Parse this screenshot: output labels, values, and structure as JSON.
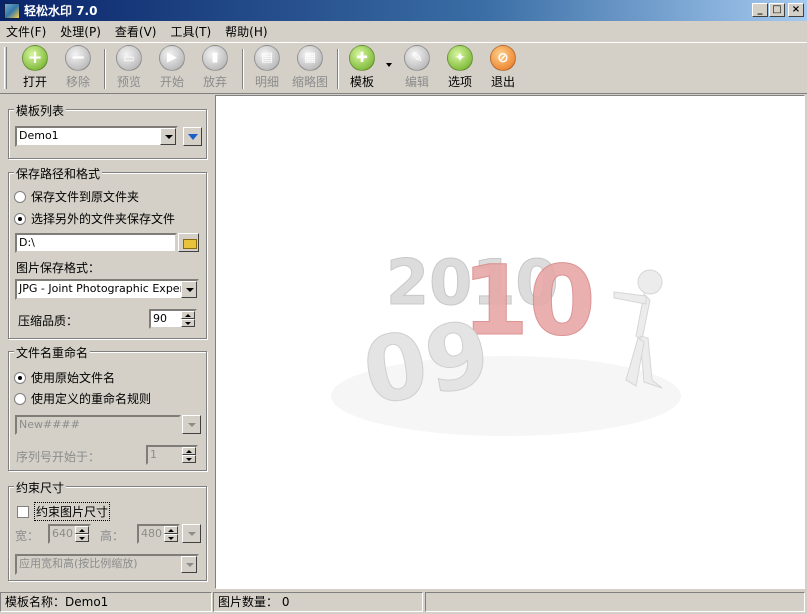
{
  "window": {
    "title": "轻松水印 7.0",
    "buttons": {
      "minimize": "_",
      "maximize": "□",
      "close": "×"
    }
  },
  "menu": [
    "文件(F)",
    "处理(P)",
    "查看(V)",
    "工具(T)",
    "帮助(H)"
  ],
  "toolbar": {
    "open": "打开",
    "remove": "移除",
    "preview": "预览",
    "start": "开始",
    "abandon": "放弃",
    "detail": "明细",
    "thumbnail": "缩略图",
    "template": "模板",
    "edit": "编辑",
    "options": "选项",
    "exit": "退出",
    "icons": {
      "open": "plus-icon",
      "remove": "minus-icon",
      "preview": "printer-icon",
      "start": "play-icon",
      "abandon": "stop-icon",
      "detail": "document-icon",
      "thumbnail": "grid-icon",
      "template": "puzzle-icon",
      "edit": "pencil-icon",
      "options": "wrench-icon",
      "exit": "cancel-icon"
    }
  },
  "template_list": {
    "legend": "模板列表",
    "selected": "Demo1"
  },
  "save_path": {
    "legend": "保存路径和格式",
    "option_original": "保存文件到原文件夹",
    "option_other": "选择另外的文件夹保存文件",
    "path": "D:\\",
    "format_label": "图片保存格式：",
    "format_value": "JPG - Joint Photographic Experts Gr",
    "quality_label": "压缩品质：",
    "quality_value": "90"
  },
  "rename": {
    "legend": "文件名重命名",
    "option_original": "使用原始文件名",
    "option_custom": "使用定义的重命名规则",
    "pattern": "New####",
    "seq_label": "序列号开始于：",
    "seq_value": "1"
  },
  "constrain": {
    "legend": "约束尺寸",
    "checkbox": "约束图片尺寸",
    "width_label": "宽：",
    "width_value": "640",
    "height_label": "高：",
    "height_value": "480",
    "mode": "应用宽和高(按比例缩放)"
  },
  "preview_image": {
    "text_2010": "2010",
    "text_09": "09"
  },
  "status": {
    "template": "模板名称：Demo1",
    "count": "图片数量： 0"
  },
  "colors": {
    "title_start": "#0a246a",
    "title_end": "#a6caf0",
    "face": "#d4d0c8",
    "accent_red": "#d83a3a"
  }
}
